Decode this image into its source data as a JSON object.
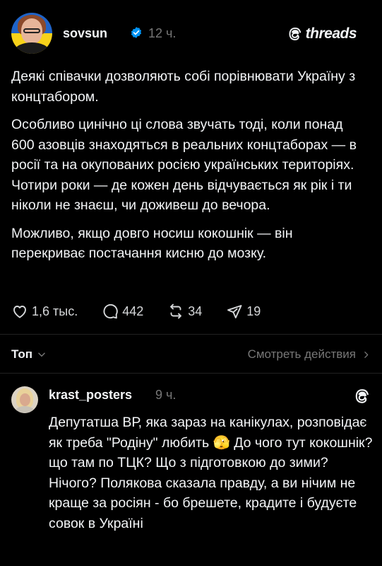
{
  "post": {
    "username": "sovsun",
    "time": "12 ч.",
    "brand": "threads",
    "paragraphs": [
      "Деякі співачки дозволяють собі порівнювати Україну з концтабором.",
      "Особливо цинічно ці слова звучать тоді, коли понад 600 азовців знаходяться в реальних концтаборах — в росії та на окупованих росією українських територіях. Чотири роки — де кожен день відчувається як рік і ти ніколи не знаєш, чи доживеш до вечора.",
      "Можливо, якщо довго носиш кокошнік — він перекриває постачання кисню до мозку."
    ],
    "actions": {
      "likes": "1,6 тыс.",
      "comments": "442",
      "reposts": "34",
      "shares": "19"
    },
    "icons": [
      "verified-badge-icon",
      "threads-logo-icon",
      "heart-icon",
      "comment-icon",
      "repost-icon",
      "share-icon"
    ]
  },
  "sort": {
    "label": "Топ",
    "view_actions": "Смотреть действия"
  },
  "reply": {
    "username": "krast_posters",
    "time": "9 ч.",
    "text": "Депутатша ВР, яка зараз на канікулах, розповідає як треба \"Родіну\" любить 🫣 До чого тут кокошнік? що там по ТЦК? Що з підготовкою до зими? Нічого? Полякова сказала правду, а ви нічим не краще за росіян - бо брешете, крадите і будуєте совок в Україні"
  },
  "colors": {
    "background": "#000000",
    "text": "#f3f5f7",
    "muted": "#777777",
    "verified": "#0095f6"
  }
}
